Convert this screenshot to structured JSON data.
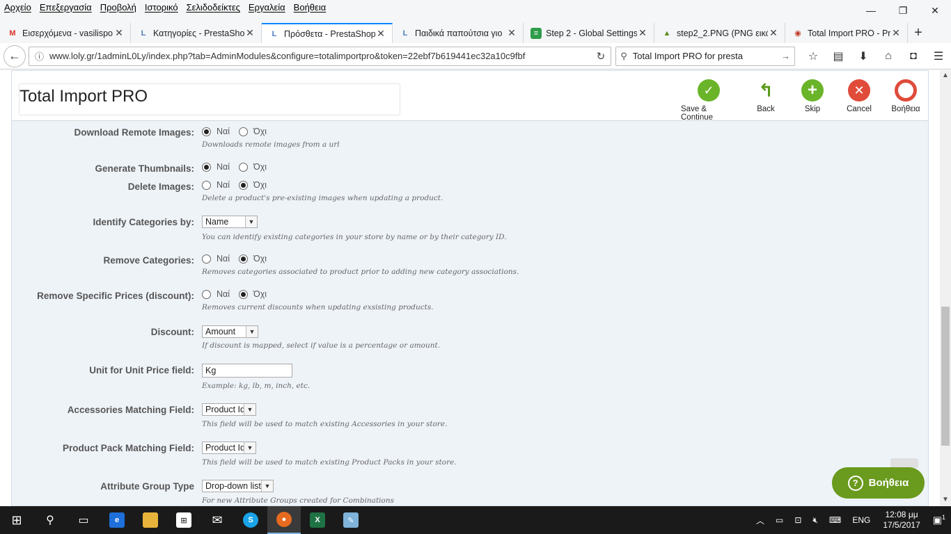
{
  "menu": [
    "Αρχείο",
    "Επεξεργασία",
    "Προβολή",
    "Ιστορικό",
    "Σελιδοδείκτες",
    "Εργαλεία",
    "Βοήθεια"
  ],
  "tabs": [
    {
      "label": "Εισερχόμενα - vasilispo",
      "fav": "M",
      "color": "#d93025",
      "active": false
    },
    {
      "label": "Κατηγορίες - PrestaSho",
      "fav": "L",
      "color": "#4a7bc0",
      "active": false
    },
    {
      "label": "Πρόσθετα - PrestaShop",
      "fav": "L",
      "color": "#4a7bc0",
      "active": true
    },
    {
      "label": "Παιδικά παπούτσια γιο",
      "fav": "L",
      "color": "#4a7bc0",
      "active": false
    },
    {
      "label": "Step 2 - Global Settings",
      "fav": "≡",
      "color": "#2e9c4a",
      "active": false
    },
    {
      "label": "step2_2.PNG (PNG εικό",
      "fav": "▲",
      "color": "#5d8c1e",
      "active": false
    },
    {
      "label": "Total Import PRO - Pres",
      "fav": "◉",
      "color": "#c0392b",
      "active": false
    }
  ],
  "url": "www.loly.gr/1adminL0Ly/index.php?tab=AdminModules&configure=totalimportpro&token=22ebf7b619441ec32a10c9fbf",
  "search": "Total Import PRO for presta",
  "page_title": "Total Import PRO",
  "toolbar": {
    "save_continue": "Save & Continue",
    "back": "Back",
    "skip": "Skip",
    "cancel": "Cancel",
    "help": "Βοήθεια"
  },
  "radio_yes": "Ναί",
  "radio_no": "Όχι",
  "fields": {
    "download_remote_images": {
      "label": "Download Remote Images:",
      "value": "yes",
      "help": "Downloads remote images from a url"
    },
    "generate_thumbnails": {
      "label": "Generate Thumbnails:",
      "value": "yes"
    },
    "delete_images": {
      "label": "Delete Images:",
      "value": "no",
      "help": "Delete a product's pre-existing images when updating a product."
    },
    "identify_categories": {
      "label": "Identify Categories by:",
      "value": "Name",
      "help": "You can identify existing categories in your store by name or by their category ID."
    },
    "remove_categories": {
      "label": "Remove Categories:",
      "value": "no",
      "help": "Removes categories associated to product prior to adding new category associations."
    },
    "remove_specific_prices": {
      "label": "Remove Specific Prices (discount):",
      "value": "no",
      "help": "Removes current discounts when updating exsisting products."
    },
    "discount": {
      "label": "Discount:",
      "value": "Amount",
      "help": "If discount is mapped, select if value is a percentage or amount."
    },
    "unit_price": {
      "label": "Unit for Unit Price field:",
      "value": "Kg",
      "help": "Example: kg, lb, m, inch, etc."
    },
    "accessories_matching": {
      "label": "Accessories Matching Field:",
      "value": "Product Id",
      "help": "This field will be used to match existing Accessories in your store."
    },
    "pack_matching": {
      "label": "Product Pack Matching Field:",
      "value": "Product Id",
      "help": "This field will be used to match existing Product Packs in your store."
    },
    "attribute_group_type": {
      "label": "Attribute Group Type",
      "value": "Drop-down list",
      "help": "For new Attribute Groups created for Combinations"
    }
  },
  "help_bubble": "Βοήθεια",
  "taskbar": {
    "lang": "ENG",
    "time": "12:08 μμ",
    "date": "17/5/2017",
    "notif_count": "1"
  }
}
